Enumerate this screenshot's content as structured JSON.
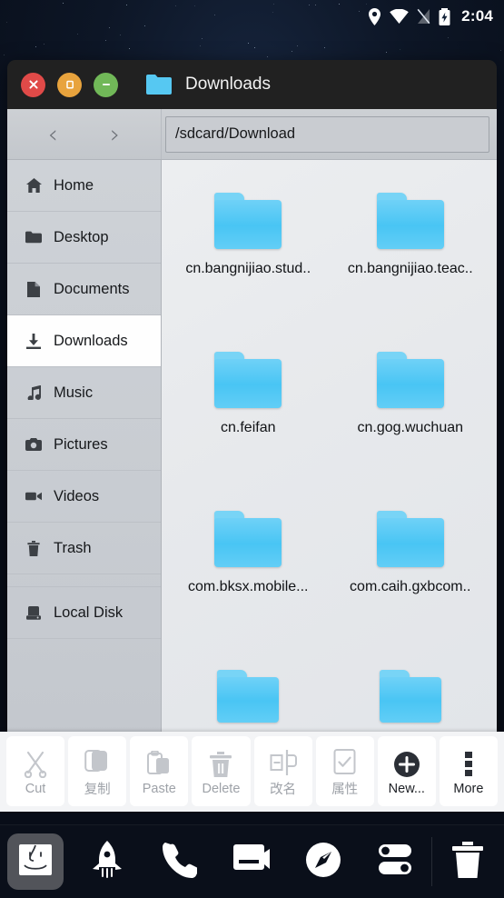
{
  "statusbar": {
    "time": "2:04",
    "icons": [
      "location-pin-icon",
      "wifi-icon",
      "signal-off-icon",
      "battery-charging-icon"
    ]
  },
  "window": {
    "title": "Downloads",
    "title_icon": "folder-icon",
    "controls": {
      "close": "close-window-button",
      "maximize": "maximize-window-button",
      "minimize": "minimize-window-button"
    },
    "nav": {
      "back": "‹",
      "forward": "›"
    },
    "path": {
      "value": "/sdcard/Download",
      "placeholder": "/sdcard/Download"
    }
  },
  "sidebar": {
    "items": [
      {
        "label": "Home",
        "icon": "home-icon",
        "active": false
      },
      {
        "label": "Desktop",
        "icon": "desktop-icon",
        "active": false
      },
      {
        "label": "Documents",
        "icon": "document-icon",
        "active": false
      },
      {
        "label": "Downloads",
        "icon": "download-icon",
        "active": true
      },
      {
        "label": "Music",
        "icon": "music-icon",
        "active": false
      },
      {
        "label": "Pictures",
        "icon": "camera-icon",
        "active": false
      },
      {
        "label": "Videos",
        "icon": "video-icon",
        "active": false
      },
      {
        "label": "Trash",
        "icon": "trash-icon",
        "active": false
      }
    ],
    "devices": [
      {
        "label": "Local Disk",
        "icon": "disk-icon",
        "active": false
      }
    ]
  },
  "files": [
    {
      "name": "cn.bangnijiao.stud..",
      "type": "folder"
    },
    {
      "name": "cn.bangnijiao.teac..",
      "type": "folder"
    },
    {
      "name": "cn.feifan",
      "type": "folder"
    },
    {
      "name": "cn.gog.wuchuan",
      "type": "folder"
    },
    {
      "name": "com.bksx.mobile...",
      "type": "folder"
    },
    {
      "name": "com.caih.gxbcom..",
      "type": "folder"
    },
    {
      "name": "",
      "type": "folder"
    },
    {
      "name": "",
      "type": "folder"
    }
  ],
  "toolbar": [
    {
      "label": "Cut",
      "icon": "scissors-icon",
      "enabled": false
    },
    {
      "label": "复制",
      "icon": "copy-icon",
      "enabled": false
    },
    {
      "label": "Paste",
      "icon": "clipboard-icon",
      "enabled": false
    },
    {
      "label": "Delete",
      "icon": "trash-icon",
      "enabled": false
    },
    {
      "label": "改名",
      "icon": "rename-icon",
      "enabled": false
    },
    {
      "label": "属性",
      "icon": "properties-checkbox-icon",
      "enabled": false
    },
    {
      "label": "New...",
      "icon": "plus-circle-icon",
      "enabled": true
    },
    {
      "label": "More",
      "icon": "more-vertical-icon",
      "enabled": true
    }
  ],
  "dock": [
    {
      "name": "finder-icon",
      "highlighted": true
    },
    {
      "name": "launchpad-icon",
      "highlighted": false
    },
    {
      "name": "phone-icon",
      "highlighted": false
    },
    {
      "name": "messages-icon",
      "highlighted": false
    },
    {
      "name": "compass-icon",
      "highlighted": false
    },
    {
      "name": "settings-icon",
      "highlighted": false
    },
    {
      "name": "trash-icon",
      "highlighted": false
    }
  ],
  "colors": {
    "wallpaper": "#0d1626",
    "titlebar": "#212121",
    "folder_blue": "#49c5f4",
    "close_red": "#e04a48",
    "max_orange": "#e8a33d",
    "min_green": "#71b858",
    "sidebar": "#c8ccd2"
  }
}
